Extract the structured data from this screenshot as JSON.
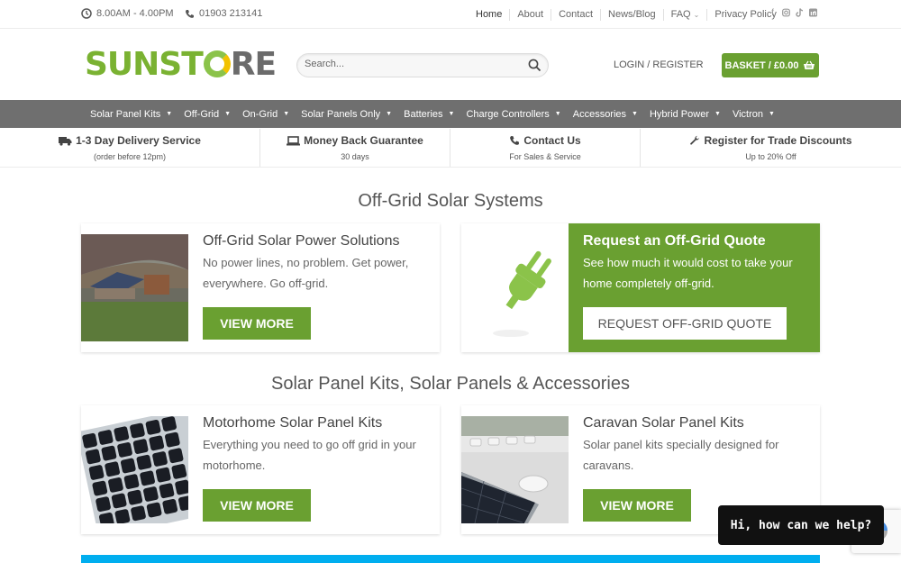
{
  "topbar": {
    "hours": "8.00AM - 4.00PM",
    "phone": "01903 213141",
    "links": [
      "Home",
      "About",
      "Contact",
      "News/Blog",
      "FAQ",
      "Privacy Policy"
    ],
    "social_icons": [
      "facebook-icon",
      "instagram-icon",
      "tiktok-icon",
      "linkedin-icon"
    ]
  },
  "header": {
    "logo": {
      "part1": "SUNST",
      "part2": "RE"
    },
    "search_placeholder": "Search...",
    "login": "LOGIN / REGISTER",
    "basket": "BASKET / £0.00"
  },
  "mainnav": [
    "Solar Panel Kits",
    "Off-Grid",
    "On-Grid",
    "Solar Panels Only",
    "Batteries",
    "Charge Controllers",
    "Accessories",
    "Hybrid Power",
    "Victron"
  ],
  "features": [
    {
      "title": "1-3 Day Delivery Service",
      "sub": "(order before 12pm)",
      "icon": "truck-icon"
    },
    {
      "title": "Money Back Guarantee",
      "sub": "30 days",
      "icon": "laptop-icon"
    },
    {
      "title": "Contact Us",
      "sub": "For Sales & Service",
      "icon": "phone-icon"
    },
    {
      "title": "Register for Trade Discounts",
      "sub": "Up to 20% Off",
      "icon": "wrench-icon"
    }
  ],
  "section1": {
    "title": "Off-Grid Solar Systems",
    "card": {
      "title": "Off-Grid Solar Power Solutions",
      "desc": "No power lines, no problem. Get power, everywhere. Go off-grid.",
      "button": "VIEW MORE"
    },
    "quote": {
      "title": "Request an Off-Grid Quote",
      "desc": "See how much it would cost to take your home completely off-grid.",
      "button": "REQUEST OFF-GRID QUOTE"
    }
  },
  "section2": {
    "title": "Solar Panel Kits, Solar Panels & Accessories",
    "cards": [
      {
        "title": "Motorhome Solar Panel Kits",
        "desc": "Everything you need to go off grid in your motorhome.",
        "button": "VIEW MORE"
      },
      {
        "title": "Caravan Solar Panel Kits",
        "desc": "Solar panel kits specially designed for caravans.",
        "button": "VIEW MORE"
      }
    ]
  },
  "chat": {
    "label": "Hi, how can we help?"
  },
  "colors": {
    "brand_green": "#6aa031",
    "nav_grey": "#6f6f6f",
    "accent_blue": "#00aeef"
  }
}
